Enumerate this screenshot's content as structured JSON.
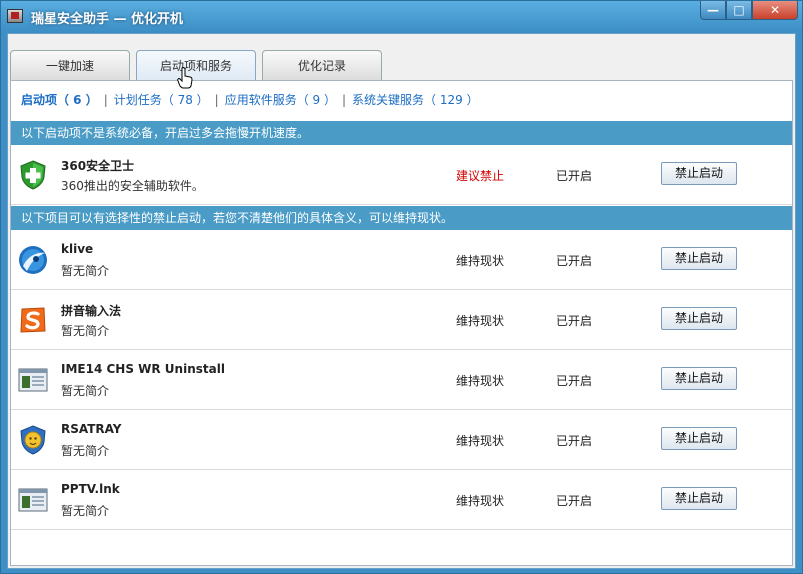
{
  "window": {
    "title": "瑞星安全助手 — 优化开机",
    "min": "—",
    "max": "□",
    "close": "✕"
  },
  "tabs": [
    {
      "label": "一键加速",
      "active": false
    },
    {
      "label": "启动项和服务",
      "active": true
    },
    {
      "label": "优化记录",
      "active": false
    }
  ],
  "subnav": {
    "items": [
      {
        "label": "启动项（ 6 ）",
        "active": true
      },
      {
        "label": "计划任务（ 78 ）",
        "active": false
      },
      {
        "label": "应用软件服务（ 9 ）",
        "active": false
      },
      {
        "label": "系统关键服务（ 129 ）",
        "active": false
      }
    ],
    "separator": "|"
  },
  "banners": {
    "unnecessary": "以下启动项不是系统必备，开启过多会拖慢开机速度。",
    "optional": "以下项目可以有选择性的禁止启动，若您不清楚他们的具体含义，可以维持现状。"
  },
  "rows_group1": [
    {
      "name": "360安全卫士",
      "desc": "360推出的安全辅助软件。",
      "advice": "建议禁止",
      "status": "已开启",
      "button": "禁止启动",
      "icon": "shield-plus-icon"
    }
  ],
  "rows_group2": [
    {
      "name": "klive",
      "desc": "暂无简介",
      "advice": "维持现状",
      "status": "已开启",
      "button": "禁止启动",
      "icon": "klive-icon"
    },
    {
      "name": "拼音输入法",
      "desc": "暂无简介",
      "advice": "维持现状",
      "status": "已开启",
      "button": "禁止启动",
      "icon": "sogou-icon"
    },
    {
      "name": "IME14 CHS WR Uninstall",
      "desc": "暂无简介",
      "advice": "维持现状",
      "status": "已开启",
      "button": "禁止启动",
      "icon": "app-window-icon"
    },
    {
      "name": "RSATRAY",
      "desc": "暂无简介",
      "advice": "维持现状",
      "status": "已开启",
      "button": "禁止启动",
      "icon": "rising-lion-icon"
    },
    {
      "name": "PPTV.lnk",
      "desc": "暂无简介",
      "advice": "维持现状",
      "status": "已开启",
      "button": "禁止启动",
      "icon": "app-window-icon"
    }
  ],
  "colors": {
    "banner": "#4a9cc6",
    "warn": "#d40000",
    "link": "#1c6dc5"
  }
}
